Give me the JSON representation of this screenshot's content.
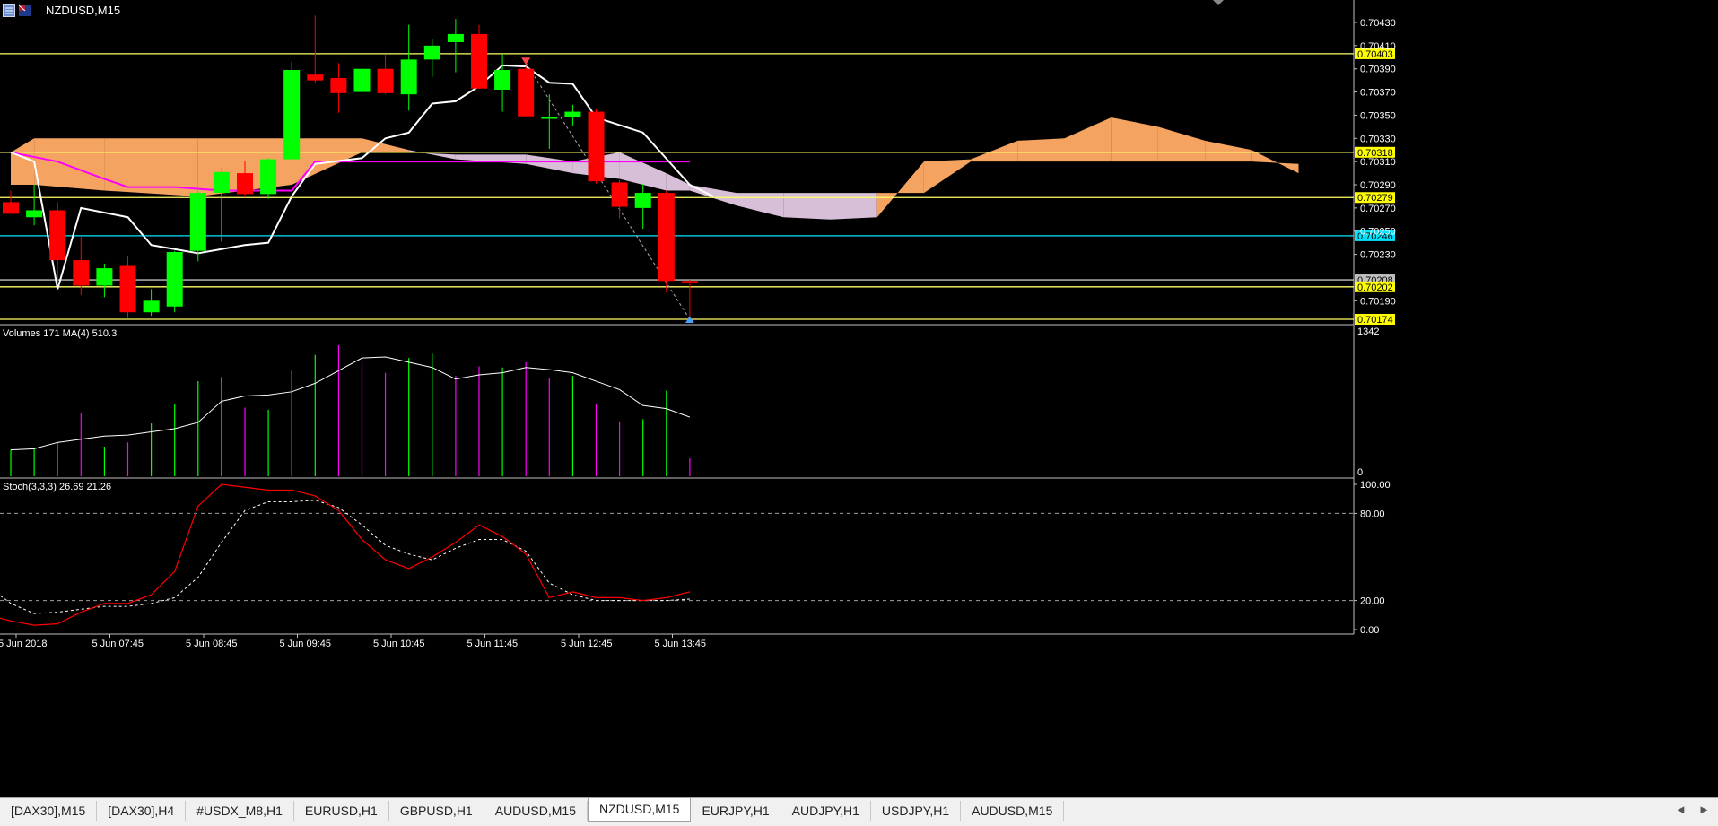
{
  "window": {
    "title": "NZDUSD,M15"
  },
  "price_scale": {
    "ticks": [
      "0.70430",
      "0.70410",
      "0.70390",
      "0.70370",
      "0.70350",
      "0.70330",
      "0.70310",
      "0.70290",
      "0.70270",
      "0.70250",
      "0.70230",
      "0.70190"
    ]
  },
  "levels": [
    {
      "price": "0.70403",
      "line_color": "#ffff66",
      "tag_bg": "#ffff00",
      "tag_fg": "#000000"
    },
    {
      "price": "0.70318",
      "line_color": "#ffff66",
      "tag_bg": "#ffff00",
      "tag_fg": "#000000"
    },
    {
      "price": "0.70279",
      "line_color": "#ffff66",
      "tag_bg": "#ffff00",
      "tag_fg": "#000000"
    },
    {
      "price": "0.70246",
      "line_color": "#00e5ff",
      "tag_bg": "#00e5ff",
      "tag_fg": "#000000"
    },
    {
      "price": "0.70208",
      "line_color": "#c0c0c0",
      "tag_bg": "#c0c0c0",
      "tag_fg": "#000000"
    },
    {
      "price": "0.70202",
      "line_color": "#ffff66",
      "tag_bg": "#ffff00",
      "tag_fg": "#000000"
    },
    {
      "price": "0.70174",
      "line_color": "#ffff66",
      "tag_bg": "#ffff00",
      "tag_fg": "#000000"
    }
  ],
  "volume_panel": {
    "label": "Volumes 171 MA(4) 510.3",
    "scale_max": "1342",
    "scale_min": "0"
  },
  "stoch_panel": {
    "label": "Stoch(3,3,3) 26.69 21.26",
    "ticks": [
      "100.00",
      "80.00",
      "20.00",
      "0.00"
    ]
  },
  "time_axis": {
    "labels": [
      "5 Jun 2018",
      "5 Jun 07:45",
      "5 Jun 08:45",
      "5 Jun 09:45",
      "5 Jun 10:45",
      "5 Jun 11:45",
      "5 Jun 12:45",
      "5 Jun 13:45"
    ]
  },
  "tabs": [
    "[DAX30],M15",
    "[DAX30],H4",
    "#USDX_M8,H1",
    "EURUSD,H1",
    "GBPUSD,H1",
    "AUDUSD,M15",
    "NZDUSD,M15",
    "EURJPY,H1",
    "AUDJPY,H1",
    "USDJPY,H1",
    "AUDUSD,M15"
  ],
  "active_tab": 6,
  "tab_arrows": {
    "left": "◄",
    "right": "►"
  },
  "colors": {
    "bull_candle": "#00ff00",
    "bear_candle": "#ff0000",
    "kumo_bull": "#d8bfd8",
    "kumo_bear": "#f4a460",
    "kijun": "#ff00ff",
    "tenkan": "#ffffff",
    "vol_up": "#00ff00",
    "vol_down": "#ff00ff",
    "stoch_main": "#ff0000",
    "stoch_signal": "#ffffff"
  },
  "chart_data": [
    {
      "type": "candlestick",
      "title": "NZDUSD,M15",
      "ylim": [
        0.70168,
        0.7044
      ],
      "candles": [
        {
          "o": 0.70275,
          "h": 0.70285,
          "l": 0.70265,
          "c": 0.70265
        },
        {
          "o": 0.70262,
          "h": 0.7029,
          "l": 0.70255,
          "c": 0.70268
        },
        {
          "o": 0.70268,
          "h": 0.70275,
          "l": 0.70205,
          "c": 0.70225
        },
        {
          "o": 0.70225,
          "h": 0.70245,
          "l": 0.70195,
          "c": 0.70203
        },
        {
          "o": 0.70203,
          "h": 0.70222,
          "l": 0.70193,
          "c": 0.70218
        },
        {
          "o": 0.7022,
          "h": 0.70228,
          "l": 0.70175,
          "c": 0.7018
        },
        {
          "o": 0.7018,
          "h": 0.702,
          "l": 0.70177,
          "c": 0.7019
        },
        {
          "o": 0.70185,
          "h": 0.70233,
          "l": 0.7018,
          "c": 0.70232
        },
        {
          "o": 0.70233,
          "h": 0.70286,
          "l": 0.70224,
          "c": 0.70283
        },
        {
          "o": 0.70283,
          "h": 0.70305,
          "l": 0.70241,
          "c": 0.70301
        },
        {
          "o": 0.703,
          "h": 0.7031,
          "l": 0.70279,
          "c": 0.70282
        },
        {
          "o": 0.70282,
          "h": 0.70313,
          "l": 0.70278,
          "c": 0.70312
        },
        {
          "o": 0.70312,
          "h": 0.70396,
          "l": 0.7031,
          "c": 0.70389
        },
        {
          "o": 0.70385,
          "h": 0.70436,
          "l": 0.70378,
          "c": 0.7038
        },
        {
          "o": 0.70382,
          "h": 0.70395,
          "l": 0.70352,
          "c": 0.70369
        },
        {
          "o": 0.7037,
          "h": 0.70394,
          "l": 0.70352,
          "c": 0.7039
        },
        {
          "o": 0.7039,
          "h": 0.70402,
          "l": 0.70368,
          "c": 0.70369
        },
        {
          "o": 0.70368,
          "h": 0.70428,
          "l": 0.70354,
          "c": 0.70398
        },
        {
          "o": 0.70398,
          "h": 0.70416,
          "l": 0.70383,
          "c": 0.7041
        },
        {
          "o": 0.70413,
          "h": 0.70433,
          "l": 0.70387,
          "c": 0.7042
        },
        {
          "o": 0.7042,
          "h": 0.70428,
          "l": 0.70373,
          "c": 0.70373
        },
        {
          "o": 0.70372,
          "h": 0.70403,
          "l": 0.70353,
          "c": 0.70389
        },
        {
          "o": 0.7039,
          "h": 0.70392,
          "l": 0.70349,
          "c": 0.70349
        },
        {
          "o": 0.70348,
          "h": 0.70368,
          "l": 0.70321,
          "c": 0.70348
        },
        {
          "o": 0.70348,
          "h": 0.70359,
          "l": 0.70341,
          "c": 0.70353
        },
        {
          "o": 0.70353,
          "h": 0.70355,
          "l": 0.70291,
          "c": 0.70293
        },
        {
          "o": 0.70292,
          "h": 0.70294,
          "l": 0.70261,
          "c": 0.70271
        },
        {
          "o": 0.7027,
          "h": 0.70291,
          "l": 0.70252,
          "c": 0.70283
        },
        {
          "o": 0.70283,
          "h": 0.70285,
          "l": 0.70197,
          "c": 0.70207
        },
        {
          "o": 0.70207,
          "h": 0.70208,
          "l": 0.70176,
          "c": 0.70206
        }
      ],
      "kumo": [
        {
          "i": 0,
          "a": 0.70318,
          "b": 0.7029
        },
        {
          "i": 1,
          "a": 0.7033,
          "b": 0.7029
        },
        {
          "i": 4,
          "a": 0.7033,
          "b": 0.70285
        },
        {
          "i": 8,
          "a": 0.7033,
          "b": 0.7028
        },
        {
          "i": 12,
          "a": 0.7033,
          "b": 0.7029
        },
        {
          "i": 15,
          "a": 0.7033,
          "b": 0.70318
        },
        {
          "i": 17,
          "a": 0.7032,
          "b": 0.70318
        },
        {
          "i": 19,
          "a": 0.70312,
          "b": 0.70316
        },
        {
          "i": 22,
          "a": 0.70308,
          "b": 0.70316
        },
        {
          "i": 24,
          "a": 0.703,
          "b": 0.7031
        },
        {
          "i": 26,
          "a": 0.70295,
          "b": 0.70318
        },
        {
          "i": 28,
          "a": 0.70285,
          "b": 0.703
        },
        {
          "i": 29,
          "a": 0.70285,
          "b": 0.7029
        },
        {
          "i": 31,
          "a": 0.70272,
          "b": 0.70283
        },
        {
          "i": 33,
          "a": 0.70262,
          "b": 0.70283
        },
        {
          "i": 35,
          "a": 0.7026,
          "b": 0.70283
        },
        {
          "i": 37,
          "a": 0.70262,
          "b": 0.70283
        },
        {
          "i": 39,
          "a": 0.7031,
          "b": 0.70283
        },
        {
          "i": 41,
          "a": 0.70312,
          "b": 0.7031
        },
        {
          "i": 43,
          "a": 0.70328,
          "b": 0.7031
        },
        {
          "i": 45,
          "a": 0.7033,
          "b": 0.7031
        },
        {
          "i": 47,
          "a": 0.70348,
          "b": 0.7031
        },
        {
          "i": 49,
          "a": 0.7034,
          "b": 0.7031
        },
        {
          "i": 51,
          "a": 0.70328,
          "b": 0.7031
        },
        {
          "i": 53,
          "a": 0.7032,
          "b": 0.7031
        },
        {
          "i": 55,
          "a": 0.703,
          "b": 0.70308
        }
      ],
      "tenkan": [
        {
          "i": 0,
          "v": 0.70318
        },
        {
          "i": 1,
          "v": 0.7031
        },
        {
          "i": 2,
          "v": 0.702
        },
        {
          "i": 3,
          "v": 0.7027
        },
        {
          "i": 5,
          "v": 0.70262
        },
        {
          "i": 6,
          "v": 0.70238
        },
        {
          "i": 8,
          "v": 0.70231
        },
        {
          "i": 10,
          "v": 0.70238
        },
        {
          "i": 11,
          "v": 0.7024
        },
        {
          "i": 12,
          "v": 0.7028
        },
        {
          "i": 13,
          "v": 0.70308
        },
        {
          "i": 15,
          "v": 0.70313
        },
        {
          "i": 16,
          "v": 0.7033
        },
        {
          "i": 17,
          "v": 0.70335
        },
        {
          "i": 18,
          "v": 0.7036
        },
        {
          "i": 19,
          "v": 0.70362
        },
        {
          "i": 20,
          "v": 0.70375
        },
        {
          "i": 21,
          "v": 0.70393
        },
        {
          "i": 22,
          "v": 0.70392
        },
        {
          "i": 23,
          "v": 0.70378
        },
        {
          "i": 24,
          "v": 0.70377
        },
        {
          "i": 25,
          "v": 0.70348
        },
        {
          "i": 27,
          "v": 0.70335
        },
        {
          "i": 29,
          "v": 0.7029
        },
        {
          "i": 30,
          "v": 0.7028
        }
      ],
      "kijun": [
        {
          "i": 0,
          "v": 0.70318
        },
        {
          "i": 2,
          "v": 0.7031
        },
        {
          "i": 4,
          "v": 0.70295
        },
        {
          "i": 5,
          "v": 0.70288
        },
        {
          "i": 7,
          "v": 0.70288
        },
        {
          "i": 9,
          "v": 0.70285
        },
        {
          "i": 12,
          "v": 0.70285
        },
        {
          "i": 13,
          "v": 0.7031
        },
        {
          "i": 15,
          "v": 0.7031
        },
        {
          "i": 29,
          "v": 0.7031
        }
      ],
      "trade_markers": {
        "sell_index": 22,
        "sell_price": 0.70395,
        "close_index": 29,
        "close_price": 0.70174
      }
    },
    {
      "type": "bar",
      "title": "Volumes 171 MA(4) 510.3",
      "ylim": [
        0,
        1342
      ],
      "values": [
        250,
        260,
        320,
        600,
        280,
        320,
        500,
        680,
        900,
        940,
        650,
        630,
        1000,
        1150,
        1240,
        1090,
        980,
        1120,
        1160,
        950,
        1040,
        1030,
        1080,
        930,
        950,
        680,
        510,
        540,
        810,
        170
      ],
      "direction": [
        "u",
        "u",
        "d",
        "d",
        "u",
        "d",
        "u",
        "u",
        "u",
        "u",
        "d",
        "u",
        "u",
        "u",
        "d",
        "d",
        "d",
        "u",
        "u",
        "d",
        "d",
        "u",
        "d",
        "d",
        "u",
        "d",
        "d",
        "u",
        "u",
        "d"
      ],
      "ma": [
        250,
        260,
        320,
        350,
        380,
        390,
        420,
        450,
        510,
        710,
        760,
        770,
        800,
        880,
        1000,
        1120,
        1130,
        1080,
        1030,
        920,
        960,
        980,
        1030,
        1010,
        980,
        900,
        820,
        670,
        640,
        560
      ]
    },
    {
      "type": "line",
      "title": "Stoch(3,3,3) 26.69 21.26",
      "ylim": [
        0,
        100
      ],
      "series": [
        {
          "values": [
            10,
            6,
            3,
            4,
            12,
            18,
            18,
            24,
            40,
            85,
            100,
            98,
            96,
            96,
            92,
            82,
            62,
            48,
            42,
            50,
            60,
            72,
            64,
            52,
            22,
            26,
            22,
            22,
            20,
            22,
            26
          ]
        },
        {
          "values": [
            30,
            18,
            11,
            12,
            14,
            16,
            16,
            18,
            22,
            36,
            60,
            82,
            88,
            88,
            89,
            84,
            72,
            58,
            52,
            48,
            56,
            62,
            62,
            54,
            32,
            24,
            20,
            20,
            20,
            20,
            21
          ]
        }
      ]
    }
  ]
}
